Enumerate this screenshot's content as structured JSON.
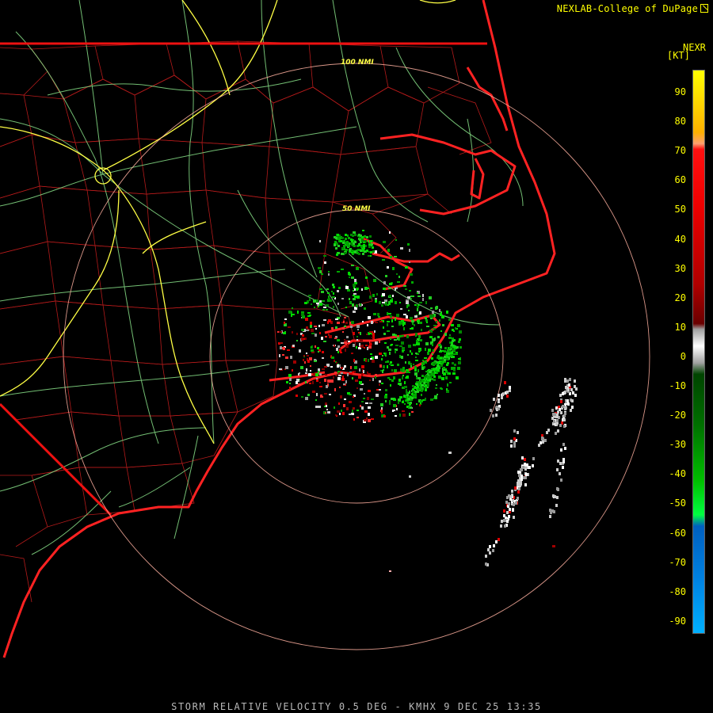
{
  "credit": "NEXLAB-College of DuPage",
  "legend": {
    "title": "NEXR",
    "unit": "[KT]",
    "ticks": [
      "90",
      "80",
      "70",
      "60",
      "50",
      "40",
      "30",
      "20",
      "10",
      "0",
      "-10",
      "-20",
      "-30",
      "-40",
      "-50",
      "-60",
      "-70",
      "-80",
      "-90"
    ]
  },
  "rings": {
    "inner_label": "50 NMI",
    "outer_label": "100 NMI"
  },
  "caption": "STORM RELATIVE VELOCITY 0.5 DEG - KMHX 9 DEC 25 13:35",
  "colors": {
    "coastline": "#ff2222",
    "county_lines": "#c81e1e",
    "highways": "#ffff44",
    "roads": "#88e088",
    "range_rings": "#ffb0a0",
    "inbound": "#00dd00",
    "outbound": "#dd0000",
    "near_zero": "#cccccc"
  }
}
